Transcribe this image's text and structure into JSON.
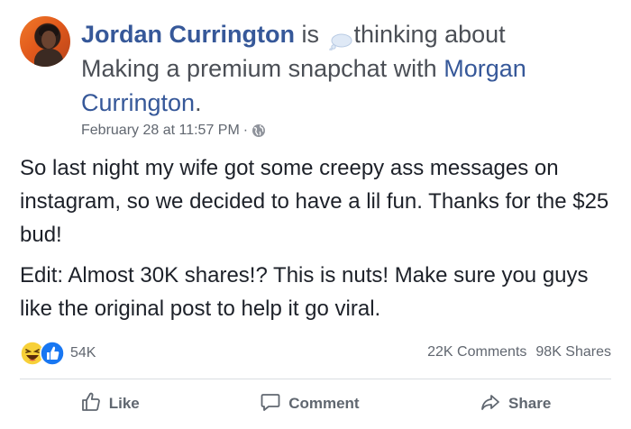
{
  "post": {
    "author": "Jordan Currington",
    "verb": "is",
    "activity": "thinking about",
    "activity_object": "Making a premium snapchat with",
    "tagged_person": "Morgan Currington",
    "tail": ".",
    "timestamp": "February 28 at 11:57 PM",
    "separator": "·",
    "privacy_icon": "globe-icon",
    "paragraphs": [
      "So last night my wife got some creepy ass messages on instagram, so we decided to have a lil fun. Thanks for the $25 bud!",
      "Edit: Almost 30K shares!? This is nuts! Make sure you guys like the original post to help it go viral."
    ]
  },
  "engagement": {
    "reaction_icons": [
      "haha-icon",
      "like-icon"
    ],
    "reaction_count": "54K",
    "comments": "22K Comments",
    "shares": "98K Shares"
  },
  "actions": {
    "like": "Like",
    "comment": "Comment",
    "share": "Share"
  },
  "colors": {
    "link": "#365899",
    "secondary_text": "#616770",
    "body_text": "#1d2129",
    "like_blue": "#1877f2",
    "haha_yellow": "#f7d038"
  }
}
